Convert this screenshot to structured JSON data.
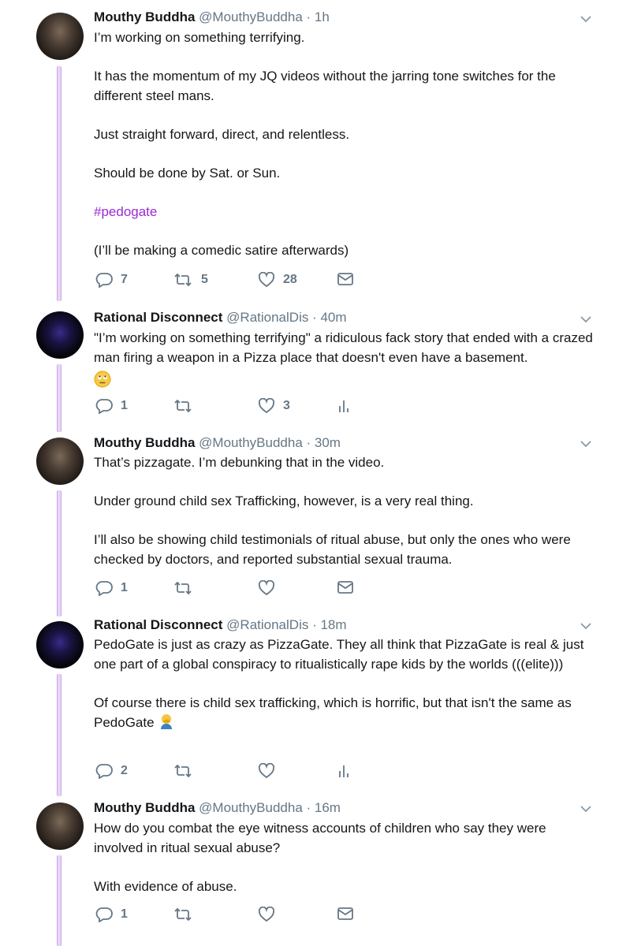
{
  "tweets": [
    {
      "name": "Mouthy Buddha",
      "handle": "@MouthyBuddha",
      "time": "· 1h",
      "paragraphs": [
        "I’m working on something terrifying.",
        "It has the momentum of my JQ videos without the jarring tone switches for the different steel mans.",
        "Just straight forward, direct, and relentless.",
        "Should be done by Sat. or Sun.",
        "#pedogate",
        "(I’ll be making a comedic satire afterwards)"
      ],
      "replies": "7",
      "retweets": "5",
      "likes": "28"
    },
    {
      "name": "Rational Disconnect",
      "handle": "@RationalDis",
      "time": "· 40m",
      "paragraphs": [
        "\"I’m working on something terrifying\" a ridiculous fack story that ended with a crazed man firing a weapon in a Pizza place that doesn't even have a basement."
      ],
      "replies": "1",
      "retweets": "",
      "likes": "3"
    },
    {
      "name": "Mouthy Buddha",
      "handle": "@MouthyBuddha",
      "time": "· 30m",
      "paragraphs": [
        "That’s pizzagate. I’m debunking that in the video.",
        "Under ground child sex Trafficking, however,  is a very real thing.",
        "I’ll also be showing child testimonials of ritual abuse, but only the ones who were checked by doctors, and reported substantial sexual trauma."
      ],
      "replies": "1",
      "retweets": "",
      "likes": ""
    },
    {
      "name": "Rational Disconnect",
      "handle": "@RationalDis",
      "time": "· 18m",
      "paragraphs": [
        "PedoGate is just as crazy as PizzaGate. They all think that PizzaGate is real & just one part of a global conspiracy to ritualistically rape kids by the worlds (((elite)))",
        "Of course there is child sex trafficking, which is horrific, but that isn't the same as PedoGate"
      ],
      "replies": "2",
      "retweets": "",
      "likes": ""
    },
    {
      "name": "Mouthy Buddha",
      "handle": "@MouthyBuddha",
      "time": "· 16m",
      "paragraphs": [
        "How do you combat the eye witness accounts of children who say they were involved in ritual sexual abuse?",
        "With evidence of abuse."
      ],
      "replies": "1",
      "retweets": "",
      "likes": ""
    }
  ],
  "icons": {
    "reply": "reply-icon",
    "retweet": "retweet-icon",
    "like": "like-icon",
    "dm": "direct-message-icon",
    "analytics": "analytics-icon",
    "caret": "chevron-down-icon"
  },
  "colors": {
    "hashtag": "#9b2ad6",
    "thread_line": "#c9a6ea",
    "muted": "#657786"
  }
}
